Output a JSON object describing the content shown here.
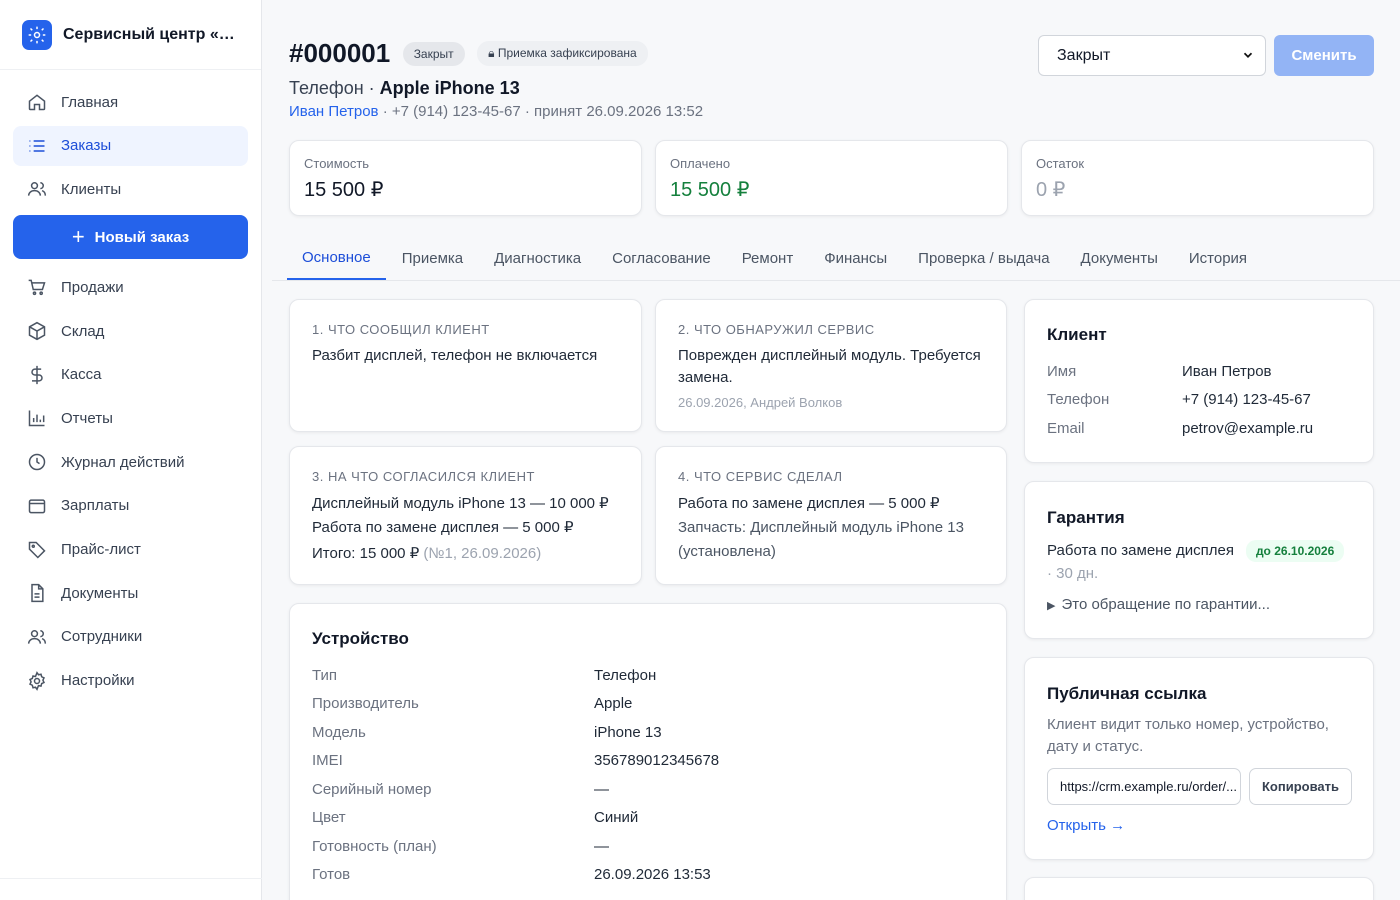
{
  "brand": {
    "name": "Сервисный центр «Ма...",
    "icon": "gear-icon"
  },
  "nav": [
    {
      "label": "Главная",
      "icon": "home-icon"
    },
    {
      "label": "Заказы",
      "icon": "list-icon",
      "active": true
    },
    {
      "label": "Клиенты",
      "icon": "users-icon"
    }
  ],
  "new_order_label": "Новый заказ",
  "nav2": [
    {
      "label": "Продажи",
      "icon": "cart-icon"
    },
    {
      "label": "Склад",
      "icon": "box-icon"
    },
    {
      "label": "Касса",
      "icon": "dollar-icon"
    },
    {
      "label": "Отчеты",
      "icon": "chart-icon"
    },
    {
      "label": "Журнал действий",
      "icon": "clock-icon"
    },
    {
      "label": "Зарплаты",
      "icon": "wallet-icon"
    },
    {
      "label": "Прайс-лист",
      "icon": "tag-icon"
    },
    {
      "label": "Документы",
      "icon": "document-icon"
    },
    {
      "label": "Сотрудники",
      "icon": "users-icon"
    },
    {
      "label": "Настройки",
      "icon": "gear-icon"
    }
  ],
  "order": {
    "number": "#000001",
    "status_badge": "Закрыт",
    "lock_badge": "Приемка зафиксирована",
    "device_type": "Телефон · ",
    "device_name": "Apple iPhone 13",
    "client_name": "Иван Петров",
    "client_meta": " · +7 (914) 123-45-67 · принят 26.09.2026 13:52"
  },
  "status_select": {
    "value": "Закрыт",
    "button": "Сменить"
  },
  "stats": [
    {
      "label": "Стоимость",
      "value": "15 500 ₽"
    },
    {
      "label": "Оплачено",
      "value": "15 500 ₽"
    },
    {
      "label": "Остаток",
      "value": "0 ₽"
    }
  ],
  "tabs": [
    "Основное",
    "Приемка",
    "Диагностика",
    "Согласование",
    "Ремонт",
    "Финансы",
    "Проверка / выдача",
    "Документы",
    "История"
  ],
  "q1": {
    "title": "1. ЧТО СООБЩИЛ КЛИЕНТ",
    "text": "Разбит дисплей, телефон не включается"
  },
  "q2": {
    "title": "2. ЧТО ОБНАРУЖИЛ СЕРВИС",
    "text": "Поврежден дисплейный модуль. Требуется замена.",
    "meta": "26.09.2026, Андрей Волков"
  },
  "q3": {
    "title": "3. НА ЧТО СОГЛАСИЛСЯ КЛИЕНТ",
    "line1": "Дисплейный модуль iPhone 13 — 10 000 ₽",
    "line2": "Работа по замене дисплея — 5 000 ₽",
    "total": "Итого: 15 000 ₽",
    "total_meta": " (№1, 26.09.2026)"
  },
  "q4": {
    "title": "4. ЧТО СЕРВИС СДЕЛАЛ",
    "line1": "Работа по замене дисплея — 5 000 ₽",
    "line2": "Запчасть: Дисплейный модуль iPhone 13 (установлена)"
  },
  "device": {
    "title": "Устройство",
    "rows": [
      {
        "k": "Тип",
        "v": "Телефон"
      },
      {
        "k": "Производитель",
        "v": "Apple"
      },
      {
        "k": "Модель",
        "v": "iPhone 13"
      },
      {
        "k": "IMEI",
        "v": "356789012345678"
      },
      {
        "k": "Серийный номер",
        "v": "—"
      },
      {
        "k": "Цвет",
        "v": "Синий"
      },
      {
        "k": "Готовность (план)",
        "v": "—"
      },
      {
        "k": "Готов",
        "v": "26.09.2026 13:53"
      }
    ]
  },
  "client": {
    "title": "Клиент",
    "rows": [
      {
        "k": "Имя",
        "v": "Иван Петров"
      },
      {
        "k": "Телефон",
        "v": "+7 (914) 123-45-67"
      },
      {
        "k": "Email",
        "v": "petrov@example.ru"
      }
    ]
  },
  "warranty": {
    "title": "Гарантия",
    "item": "Работа по замене дисплея",
    "badge": "до 26.10.2026",
    "days": "· 30 дн.",
    "details": "Это обращение по гарантии..."
  },
  "public_link": {
    "title": "Публичная ссылка",
    "desc": "Клиент видит только номер, устройство, дату и статус.",
    "url": "https://crm.example.ru/order/...",
    "copy": "Копировать",
    "open": "Открыть →"
  },
  "colors": {
    "accent": "#2563eb",
    "green": "#15803d"
  }
}
